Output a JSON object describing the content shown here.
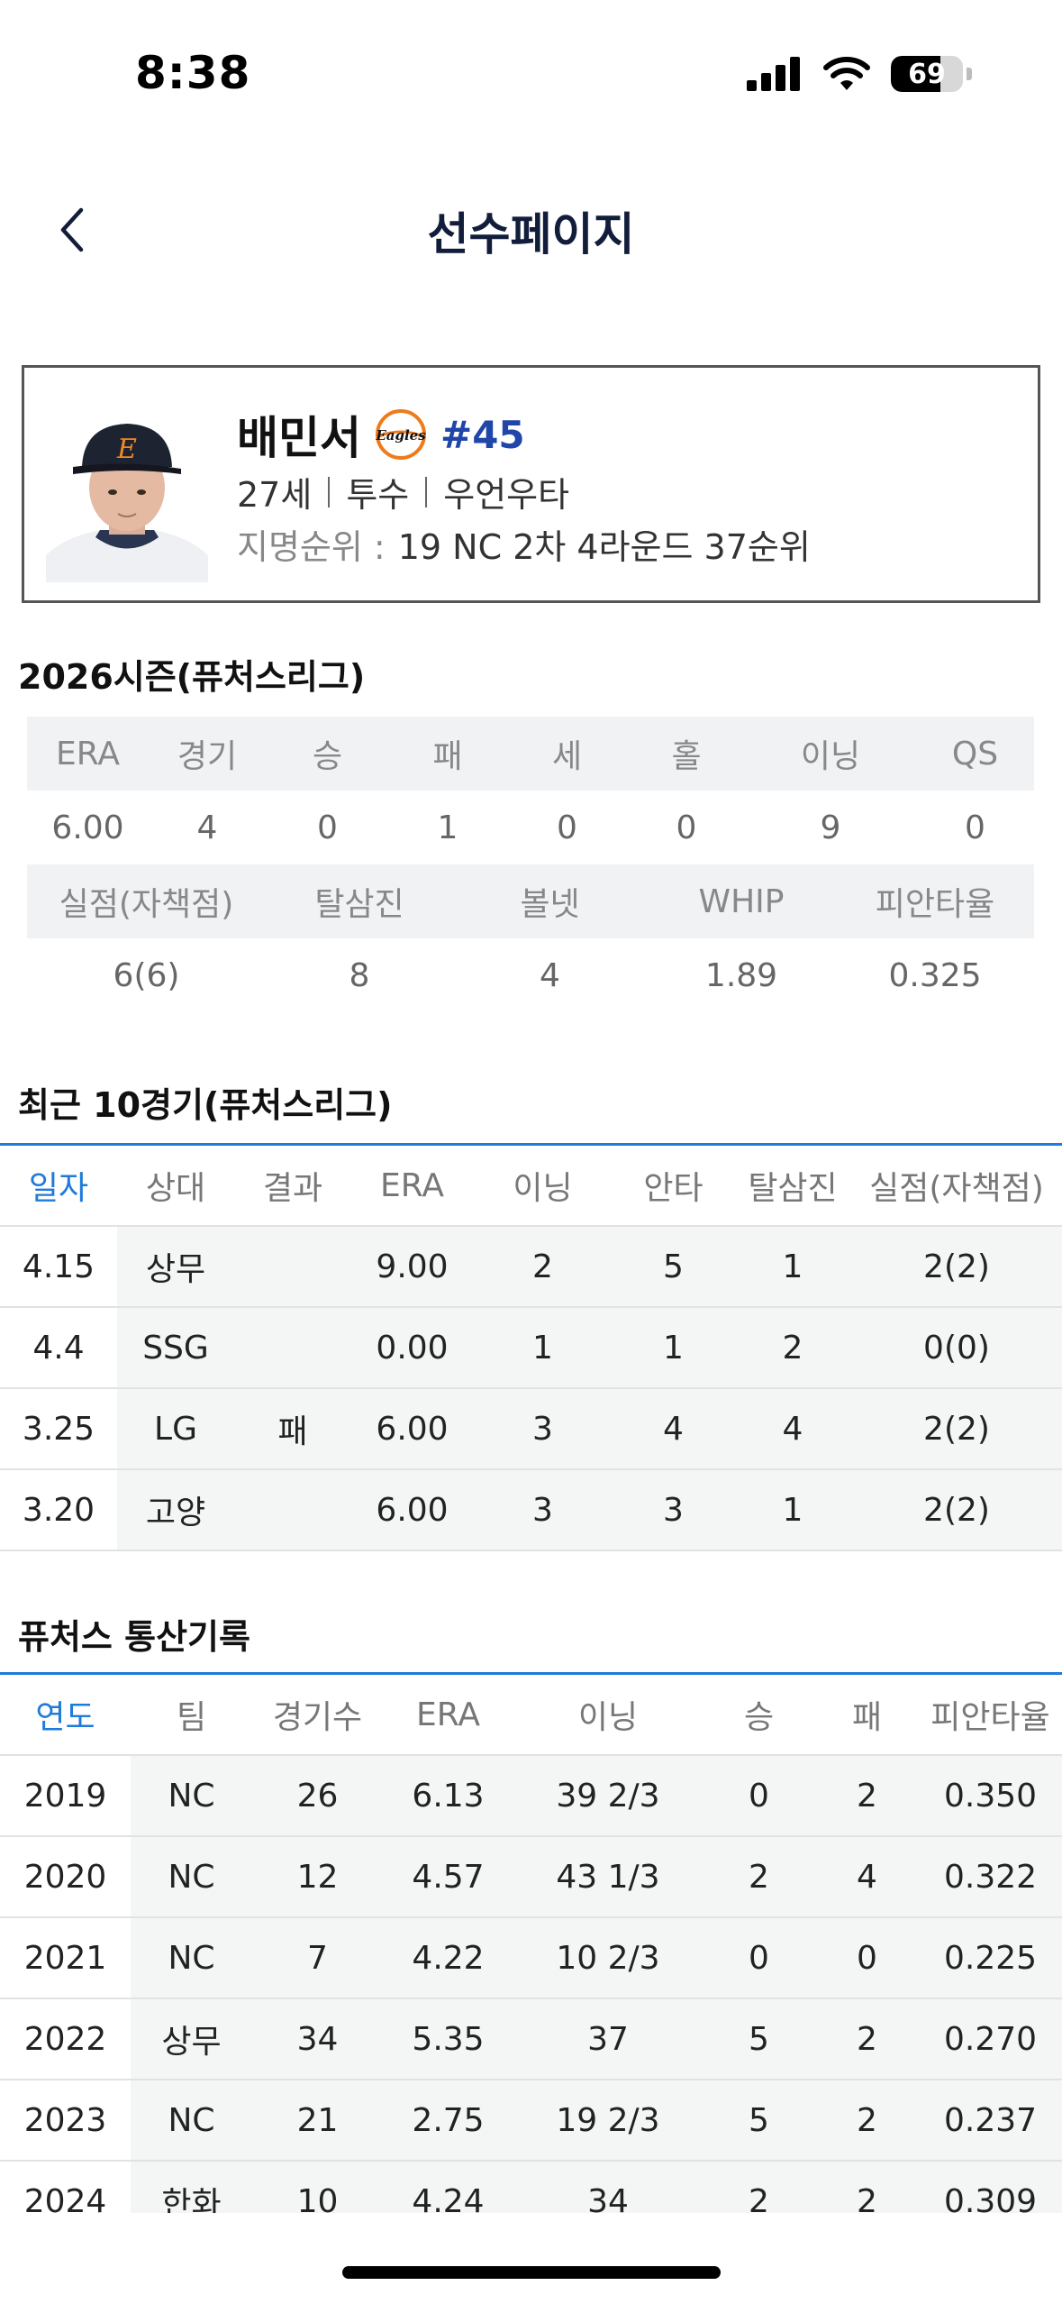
{
  "status_bar": {
    "time": "8:38",
    "battery": "69",
    "battery_level": 0.69
  },
  "nav": {
    "title": "선수페이지"
  },
  "player": {
    "name": "배민서",
    "number": "#45",
    "team_logo_text": "Eagles",
    "age": "27세",
    "position": "투수",
    "bat_throw": "우언우타",
    "draft_label": "지명순위 :",
    "draft_value": "19 NC 2차 4라운드 37순위"
  },
  "season": {
    "title": "2026시즌(퓨처스리그)",
    "row1_headers": [
      "ERA",
      "경기",
      "승",
      "패",
      "세",
      "홀",
      "이닝",
      "QS"
    ],
    "row1_values": [
      "6.00",
      "4",
      "0",
      "1",
      "0",
      "0",
      "9",
      "0"
    ],
    "row2_headers": [
      "실점(자책점)",
      "탈삼진",
      "볼넷",
      "WHIP",
      "피안타율"
    ],
    "row2_values": [
      "6(6)",
      "8",
      "4",
      "1.89",
      "0.325"
    ]
  },
  "recent": {
    "title": "최근 10경기(퓨처스리그)",
    "headers": [
      "일자",
      "상대",
      "결과",
      "ERA",
      "이닝",
      "안타",
      "탈삼진",
      "실점(자책점)"
    ],
    "rows": [
      [
        "4.15",
        "상무",
        "",
        "9.00",
        "2",
        "5",
        "1",
        "2(2)"
      ],
      [
        "4.4",
        "SSG",
        "",
        "0.00",
        "1",
        "1",
        "2",
        "0(0)"
      ],
      [
        "3.25",
        "LG",
        "패",
        "6.00",
        "3",
        "4",
        "4",
        "2(2)"
      ],
      [
        "3.20",
        "고양",
        "",
        "6.00",
        "3",
        "3",
        "1",
        "2(2)"
      ]
    ]
  },
  "career": {
    "title": "퓨처스 통산기록",
    "headers": [
      "연도",
      "팀",
      "경기수",
      "ERA",
      "이닝",
      "승",
      "패",
      "피안타율"
    ],
    "rows": [
      [
        "2019",
        "NC",
        "26",
        "6.13",
        "39 2/3",
        "0",
        "2",
        "0.350"
      ],
      [
        "2020",
        "NC",
        "12",
        "4.57",
        "43 1/3",
        "2",
        "4",
        "0.322"
      ],
      [
        "2021",
        "NC",
        "7",
        "4.22",
        "10 2/3",
        "0",
        "0",
        "0.225"
      ],
      [
        "2022",
        "상무",
        "34",
        "5.35",
        "37",
        "5",
        "2",
        "0.270"
      ],
      [
        "2023",
        "NC",
        "21",
        "2.75",
        "19 2/3",
        "5",
        "2",
        "0.237"
      ],
      [
        "2024",
        "한화",
        "10",
        "4.24",
        "34",
        "2",
        "2",
        "0.309"
      ]
    ]
  },
  "icons": {
    "back": "chevron-left-icon",
    "signal": "cellular-signal-icon",
    "wifi": "wifi-icon",
    "battery": "battery-icon"
  }
}
